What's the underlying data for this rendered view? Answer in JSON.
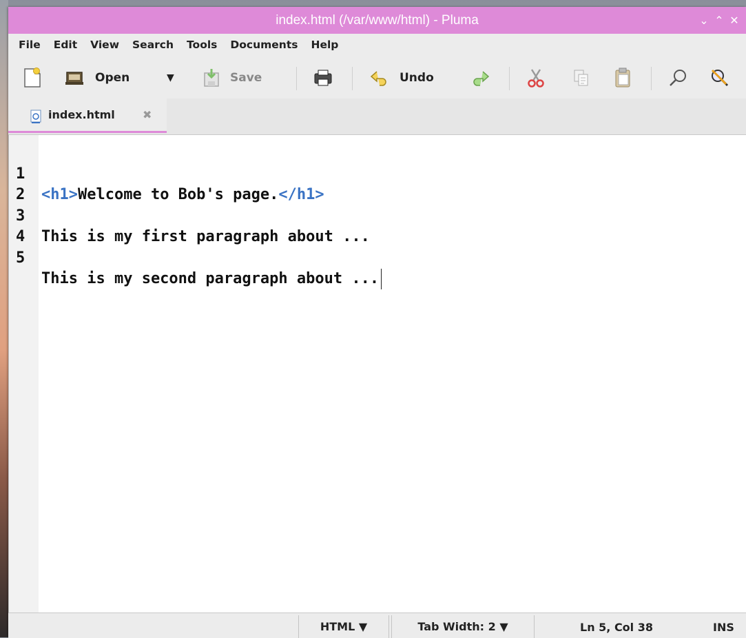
{
  "window": {
    "title": "index.html (/var/www/html) - Pluma",
    "controls": {
      "minimize": "⌄",
      "maximize": "⌃",
      "close": "✕"
    }
  },
  "menu": [
    "File",
    "Edit",
    "View",
    "Search",
    "Tools",
    "Documents",
    "Help"
  ],
  "toolbar": {
    "new_icon": "new-document-icon",
    "open_label": "Open",
    "open_dropdown": "▼",
    "save_label": "Save",
    "print_icon": "printer-icon",
    "undo_label": "Undo",
    "redo_icon": "redo-icon",
    "cut_icon": "scissors-icon",
    "copy_icon": "copy-icon",
    "paste_icon": "paste-icon",
    "find_icon": "magnifier-icon",
    "replace_icon": "find-replace-icon"
  },
  "tab": {
    "label": "index.html",
    "close": "✖"
  },
  "editor": {
    "lines": [
      {
        "num": "1",
        "tag_open": "<h1>",
        "text": "Welcome to Bob's page.",
        "tag_close": "</h1>"
      },
      {
        "num": "2",
        "text": ""
      },
      {
        "num": "3",
        "text": "This is my first paragraph about ..."
      },
      {
        "num": "4",
        "text": ""
      },
      {
        "num": "5",
        "text": "This is my second paragraph about ..."
      }
    ]
  },
  "status": {
    "language": "HTML ▼",
    "tab_width": "Tab Width: 2 ▼",
    "position": "Ln 5, Col 38",
    "mode": "INS"
  },
  "colors": {
    "accent": "#de8ad8",
    "tag": "#3a73c4"
  }
}
